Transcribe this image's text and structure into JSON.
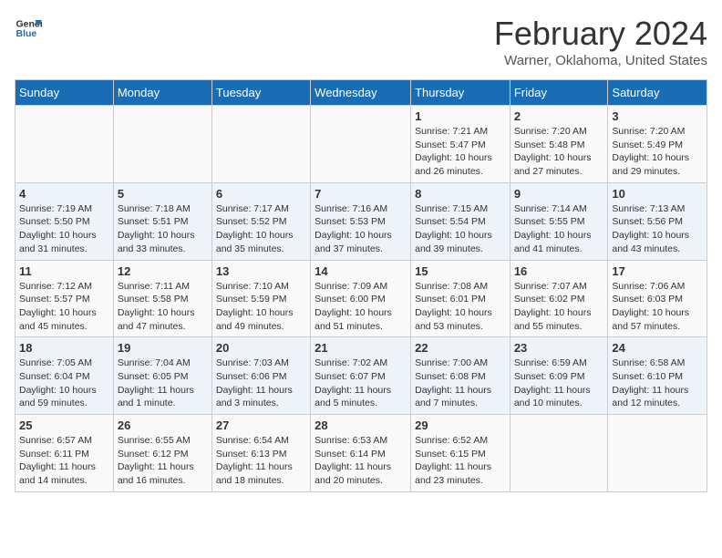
{
  "logo": {
    "line1": "General",
    "line2": "Blue"
  },
  "title": "February 2024",
  "subtitle": "Warner, Oklahoma, United States",
  "days_of_week": [
    "Sunday",
    "Monday",
    "Tuesday",
    "Wednesday",
    "Thursday",
    "Friday",
    "Saturday"
  ],
  "weeks": [
    [
      {
        "day": "",
        "sunrise": "",
        "sunset": "",
        "daylight": ""
      },
      {
        "day": "",
        "sunrise": "",
        "sunset": "",
        "daylight": ""
      },
      {
        "day": "",
        "sunrise": "",
        "sunset": "",
        "daylight": ""
      },
      {
        "day": "",
        "sunrise": "",
        "sunset": "",
        "daylight": ""
      },
      {
        "day": "1",
        "sunrise": "Sunrise: 7:21 AM",
        "sunset": "Sunset: 5:47 PM",
        "daylight": "Daylight: 10 hours and 26 minutes."
      },
      {
        "day": "2",
        "sunrise": "Sunrise: 7:20 AM",
        "sunset": "Sunset: 5:48 PM",
        "daylight": "Daylight: 10 hours and 27 minutes."
      },
      {
        "day": "3",
        "sunrise": "Sunrise: 7:20 AM",
        "sunset": "Sunset: 5:49 PM",
        "daylight": "Daylight: 10 hours and 29 minutes."
      }
    ],
    [
      {
        "day": "4",
        "sunrise": "Sunrise: 7:19 AM",
        "sunset": "Sunset: 5:50 PM",
        "daylight": "Daylight: 10 hours and 31 minutes."
      },
      {
        "day": "5",
        "sunrise": "Sunrise: 7:18 AM",
        "sunset": "Sunset: 5:51 PM",
        "daylight": "Daylight: 10 hours and 33 minutes."
      },
      {
        "day": "6",
        "sunrise": "Sunrise: 7:17 AM",
        "sunset": "Sunset: 5:52 PM",
        "daylight": "Daylight: 10 hours and 35 minutes."
      },
      {
        "day": "7",
        "sunrise": "Sunrise: 7:16 AM",
        "sunset": "Sunset: 5:53 PM",
        "daylight": "Daylight: 10 hours and 37 minutes."
      },
      {
        "day": "8",
        "sunrise": "Sunrise: 7:15 AM",
        "sunset": "Sunset: 5:54 PM",
        "daylight": "Daylight: 10 hours and 39 minutes."
      },
      {
        "day": "9",
        "sunrise": "Sunrise: 7:14 AM",
        "sunset": "Sunset: 5:55 PM",
        "daylight": "Daylight: 10 hours and 41 minutes."
      },
      {
        "day": "10",
        "sunrise": "Sunrise: 7:13 AM",
        "sunset": "Sunset: 5:56 PM",
        "daylight": "Daylight: 10 hours and 43 minutes."
      }
    ],
    [
      {
        "day": "11",
        "sunrise": "Sunrise: 7:12 AM",
        "sunset": "Sunset: 5:57 PM",
        "daylight": "Daylight: 10 hours and 45 minutes."
      },
      {
        "day": "12",
        "sunrise": "Sunrise: 7:11 AM",
        "sunset": "Sunset: 5:58 PM",
        "daylight": "Daylight: 10 hours and 47 minutes."
      },
      {
        "day": "13",
        "sunrise": "Sunrise: 7:10 AM",
        "sunset": "Sunset: 5:59 PM",
        "daylight": "Daylight: 10 hours and 49 minutes."
      },
      {
        "day": "14",
        "sunrise": "Sunrise: 7:09 AM",
        "sunset": "Sunset: 6:00 PM",
        "daylight": "Daylight: 10 hours and 51 minutes."
      },
      {
        "day": "15",
        "sunrise": "Sunrise: 7:08 AM",
        "sunset": "Sunset: 6:01 PM",
        "daylight": "Daylight: 10 hours and 53 minutes."
      },
      {
        "day": "16",
        "sunrise": "Sunrise: 7:07 AM",
        "sunset": "Sunset: 6:02 PM",
        "daylight": "Daylight: 10 hours and 55 minutes."
      },
      {
        "day": "17",
        "sunrise": "Sunrise: 7:06 AM",
        "sunset": "Sunset: 6:03 PM",
        "daylight": "Daylight: 10 hours and 57 minutes."
      }
    ],
    [
      {
        "day": "18",
        "sunrise": "Sunrise: 7:05 AM",
        "sunset": "Sunset: 6:04 PM",
        "daylight": "Daylight: 10 hours and 59 minutes."
      },
      {
        "day": "19",
        "sunrise": "Sunrise: 7:04 AM",
        "sunset": "Sunset: 6:05 PM",
        "daylight": "Daylight: 11 hours and 1 minute."
      },
      {
        "day": "20",
        "sunrise": "Sunrise: 7:03 AM",
        "sunset": "Sunset: 6:06 PM",
        "daylight": "Daylight: 11 hours and 3 minutes."
      },
      {
        "day": "21",
        "sunrise": "Sunrise: 7:02 AM",
        "sunset": "Sunset: 6:07 PM",
        "daylight": "Daylight: 11 hours and 5 minutes."
      },
      {
        "day": "22",
        "sunrise": "Sunrise: 7:00 AM",
        "sunset": "Sunset: 6:08 PM",
        "daylight": "Daylight: 11 hours and 7 minutes."
      },
      {
        "day": "23",
        "sunrise": "Sunrise: 6:59 AM",
        "sunset": "Sunset: 6:09 PM",
        "daylight": "Daylight: 11 hours and 10 minutes."
      },
      {
        "day": "24",
        "sunrise": "Sunrise: 6:58 AM",
        "sunset": "Sunset: 6:10 PM",
        "daylight": "Daylight: 11 hours and 12 minutes."
      }
    ],
    [
      {
        "day": "25",
        "sunrise": "Sunrise: 6:57 AM",
        "sunset": "Sunset: 6:11 PM",
        "daylight": "Daylight: 11 hours and 14 minutes."
      },
      {
        "day": "26",
        "sunrise": "Sunrise: 6:55 AM",
        "sunset": "Sunset: 6:12 PM",
        "daylight": "Daylight: 11 hours and 16 minutes."
      },
      {
        "day": "27",
        "sunrise": "Sunrise: 6:54 AM",
        "sunset": "Sunset: 6:13 PM",
        "daylight": "Daylight: 11 hours and 18 minutes."
      },
      {
        "day": "28",
        "sunrise": "Sunrise: 6:53 AM",
        "sunset": "Sunset: 6:14 PM",
        "daylight": "Daylight: 11 hours and 20 minutes."
      },
      {
        "day": "29",
        "sunrise": "Sunrise: 6:52 AM",
        "sunset": "Sunset: 6:15 PM",
        "daylight": "Daylight: 11 hours and 23 minutes."
      },
      {
        "day": "",
        "sunrise": "",
        "sunset": "",
        "daylight": ""
      },
      {
        "day": "",
        "sunrise": "",
        "sunset": "",
        "daylight": ""
      }
    ]
  ]
}
